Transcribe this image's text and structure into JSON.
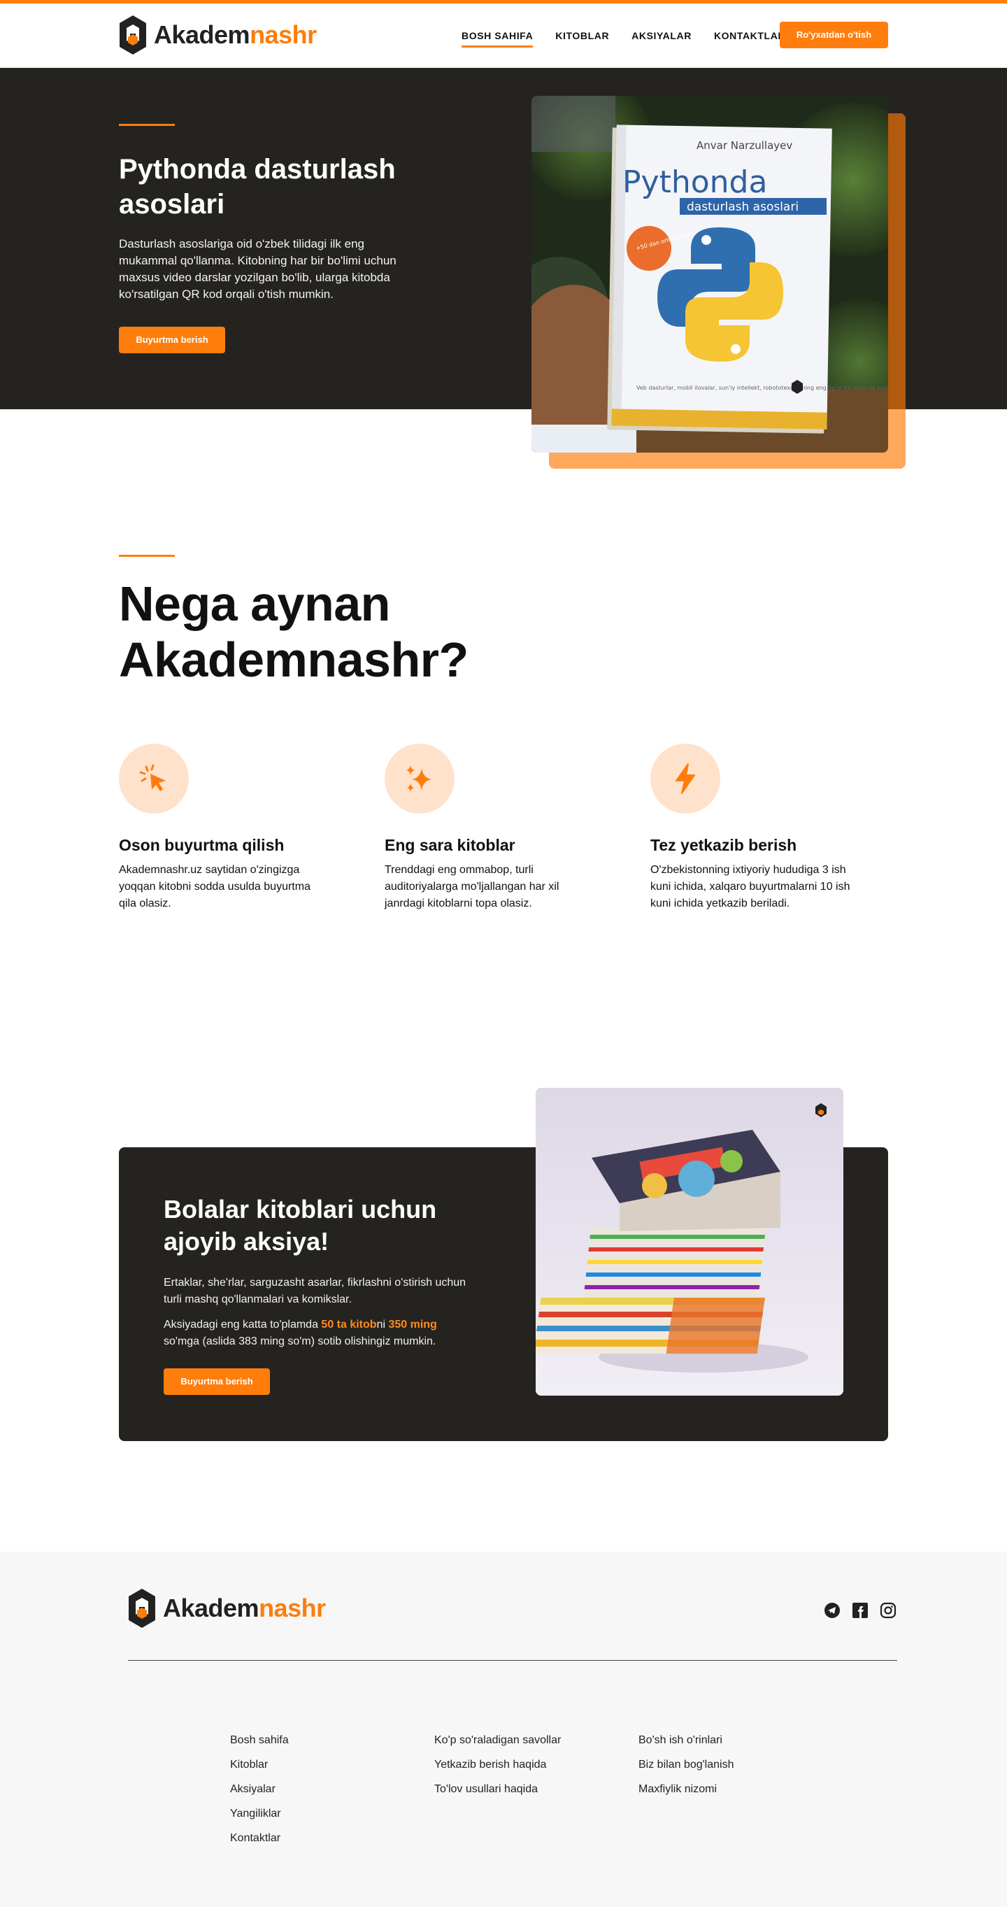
{
  "brand": {
    "name_dark": "Akadem",
    "name_accent": "nashr",
    "accent_color": "#ff7d0c",
    "dark_color": "#252320"
  },
  "nav": {
    "items": [
      {
        "label": "BOSH SAHIFA",
        "active": true
      },
      {
        "label": "KITOBLAR",
        "active": false
      },
      {
        "label": "AKSIYALAR",
        "active": false
      },
      {
        "label": "KONTAKTLAR",
        "active": false
      }
    ],
    "signup_label": "Ro'yxatdan o'tish"
  },
  "hero": {
    "title": "Pythonda dasturlash asoslari",
    "description": "Dasturlash asoslariga oid o'zbek tilidagi ilk eng mukammal qo'llanma. Kitobning har bir bo'limi uchun maxsus video darslar yozilgan bo'lib, ularga kitobda ko'rsatilgan QR kod orqali o'tish mumkin.",
    "button_label": "Buyurtma berish",
    "book": {
      "author": "Anvar Narzullayev",
      "title": "Pythonda",
      "subtitle": "dasturlash asoslari",
      "badge": "+50 dan ortiq video darslar",
      "footer": "Veb dasturlar, mobil ilovalar, sun'iy intellekt, robototexnikaning eng ilg'or tili asosi va mukammal o'rgatuvchi qo'llanma"
    }
  },
  "why": {
    "title": "Nega aynan Akademnashr?",
    "features": [
      {
        "icon": "cursor-click-icon",
        "title": "Oson buyurtma qilish",
        "text": "Akademnashr.uz saytidan o'zingizga yoqqan kitobni sodda usulda buyurtma qila olasiz."
      },
      {
        "icon": "sparkles-icon",
        "title": "Eng sara kitoblar",
        "text": "Trenddagi eng ommabop, turli auditoriyalarga mo'ljallangan har xil janrdagi kitoblarni topa olasiz."
      },
      {
        "icon": "lightning-icon",
        "title": "Tez yetkazib berish",
        "text": "O'zbekistonning ixtiyoriy hududiga 3 ish kuni ichida, xalqaro buyurtmalarni 10 ish kuni ichida yetkazib beriladi."
      }
    ]
  },
  "promo": {
    "title": "Bolalar kitoblari uchun ajoyib aksiya!",
    "text1": "Ertaklar, she'rlar, sarguzasht asarlar, fikrlashni o'stirish uchun turli mashq qo'llanmalari va komikslar.",
    "text2_pre": "Aksiyadagi eng katta to'plamda ",
    "text2_hl1": "50 ta kitob",
    "text2_mid": "ni ",
    "text2_hl2": "350 ming",
    "text2_post": " so'mga (aslida 383 ming so'm) sotib olishingiz mumkin.",
    "button_label": "Buyurtma berish"
  },
  "footer": {
    "social": [
      "telegram-icon",
      "facebook-icon",
      "instagram-icon"
    ],
    "col1": [
      "Bosh sahifa",
      "Kitoblar",
      "Aksiyalar",
      "Yangiliklar",
      "Kontaktlar"
    ],
    "col2": [
      "Ko'p so'raladigan savollar",
      "Yetkazib berish haqida",
      "To'lov usullari haqida"
    ],
    "col3": [
      "Bo'sh ish o'rinlari",
      "Biz bilan bog'lanish",
      "Maxfiylik nizomi"
    ]
  }
}
